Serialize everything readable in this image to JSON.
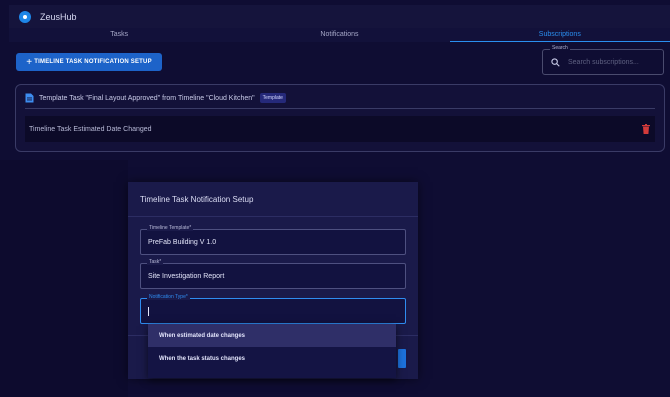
{
  "app": {
    "title": "ZeusHub"
  },
  "tabs": [
    {
      "label": "Tasks",
      "active": false
    },
    {
      "label": "Notifications",
      "active": false
    },
    {
      "label": "Subscriptions",
      "active": true
    }
  ],
  "toolbar": {
    "add_label": "TIMELINE TASK NOTIFICATION SETUP",
    "add_icon": "plus-icon"
  },
  "search": {
    "label": "Search",
    "placeholder": "Search subscriptions...",
    "icon": "search-icon"
  },
  "subscription": {
    "title": "Template Task \"Final Layout Approved\" from Timeline \"Cloud Kitchen\"",
    "badge": "Template",
    "row_label": "Timeline Task Estimated Date Changed",
    "delete_icon": "trash-icon"
  },
  "modal": {
    "title": "Timeline Task Notification Setup",
    "fields": [
      {
        "label": "Timeline Template*",
        "value": "PreFab Building V 1.0"
      },
      {
        "label": "Task*",
        "value": "Site Investigation Report"
      },
      {
        "label": "Notification Type*",
        "value": ""
      }
    ],
    "options": [
      "When estimated date changes",
      "When the task status changes"
    ]
  },
  "colors": {
    "accent": "#2a8ff0",
    "background": "#0f0d33",
    "danger": "#d23a3a"
  }
}
